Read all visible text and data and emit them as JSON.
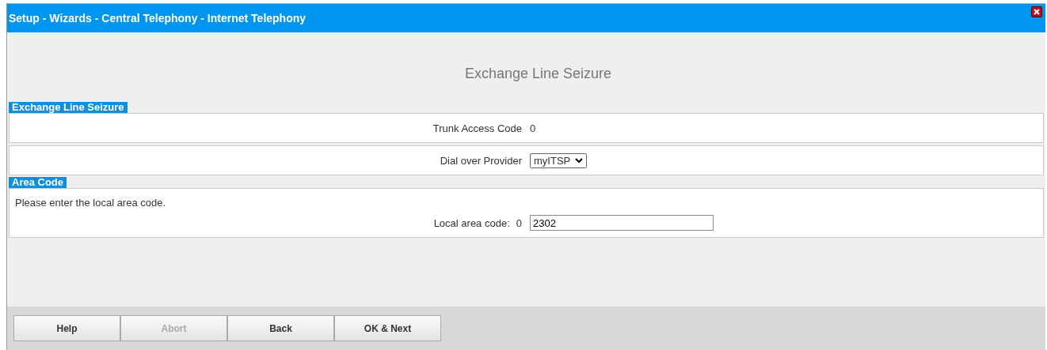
{
  "window": {
    "title": "Setup - Wizards - Central Telephony - Internet Telephony"
  },
  "heading": "Exchange Line Seizure",
  "sections": [
    {
      "title": "Exchange Line Seizure",
      "rows": [
        {
          "kind": "text",
          "label": "Trunk Access Code",
          "value": "0"
        },
        {
          "kind": "select",
          "label": "Dial over Provider",
          "value": "myITSP"
        }
      ]
    },
    {
      "title": "Area Code",
      "description": "Please enter the local area code.",
      "rows": [
        {
          "kind": "input",
          "label": "Local area code:",
          "prefix": "0",
          "value": "2302"
        }
      ]
    }
  ],
  "buttons": [
    {
      "label": "Help",
      "disabled": false
    },
    {
      "label": "Abort",
      "disabled": true
    },
    {
      "label": "Back",
      "disabled": false
    },
    {
      "label": "OK & Next",
      "disabled": false
    }
  ]
}
